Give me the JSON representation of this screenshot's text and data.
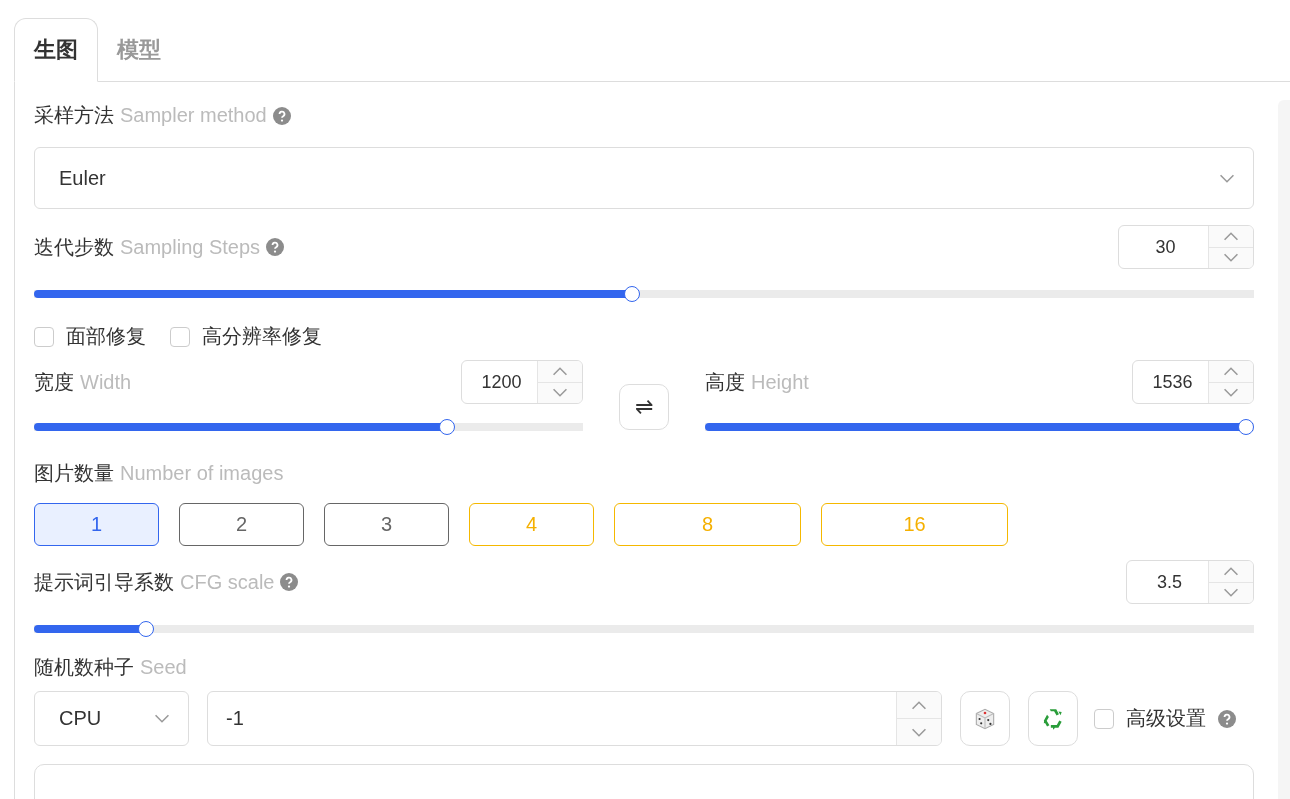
{
  "tabs": [
    {
      "label": "生图",
      "selected": true
    },
    {
      "label": "模型",
      "selected": false
    }
  ],
  "sampler": {
    "label": "采样方法",
    "label_en": "Sampler method",
    "value": "Euler"
  },
  "steps": {
    "label": "迭代步数",
    "label_en": "Sampling Steps",
    "value": "30",
    "level": 0.49
  },
  "options": [
    {
      "label": "面部修复",
      "checked": false
    },
    {
      "label": "高分辨率修复",
      "checked": false
    }
  ],
  "width": {
    "label": "宽度",
    "label_en": "Width",
    "value": "1200",
    "level": 0.76
  },
  "height": {
    "label": "高度",
    "label_en": "Height",
    "value": "1536",
    "level": 1.0
  },
  "swap": {
    "glyph": "⇌"
  },
  "images": {
    "label": "图片数量",
    "label_en": "Number of images",
    "choices": [
      {
        "label": "1",
        "selected": true,
        "kind": "normal"
      },
      {
        "label": "2",
        "selected": false,
        "kind": "normal"
      },
      {
        "label": "3",
        "selected": false,
        "kind": "normal"
      },
      {
        "label": "4",
        "selected": false,
        "kind": "warning"
      },
      {
        "label": "8",
        "selected": false,
        "kind": "warning"
      },
      {
        "label": "16",
        "selected": false,
        "kind": "warning"
      }
    ]
  },
  "cfg": {
    "label": "提示词引导系数",
    "label_en": "CFG scale",
    "value": "3.5",
    "level": 0.086
  },
  "seed": {
    "label": "随机数种子",
    "label_en": "Seed",
    "device": "CPU",
    "value": "-1"
  },
  "advanced": {
    "label": "高级设置",
    "checked": false
  }
}
